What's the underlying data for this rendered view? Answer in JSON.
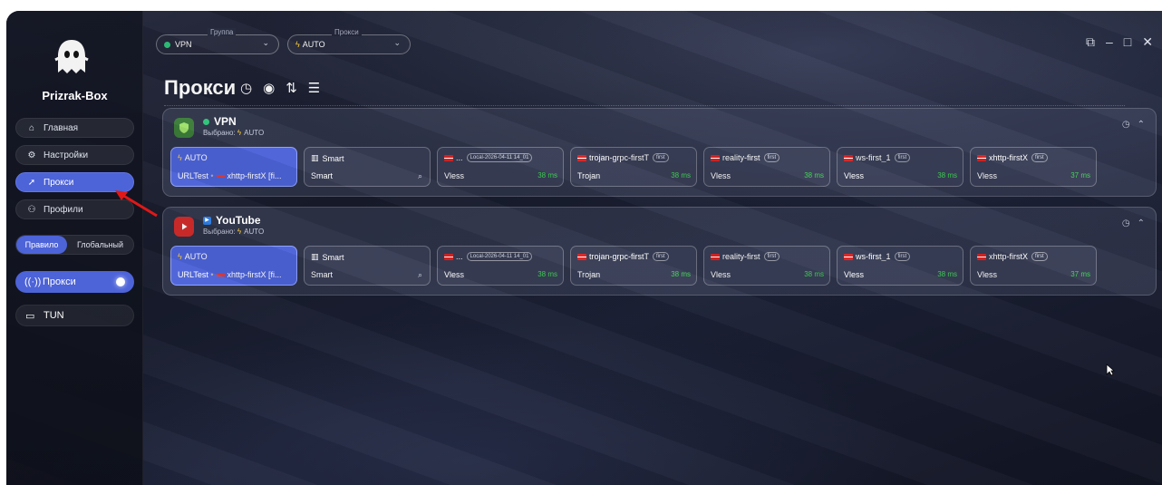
{
  "brand": "Prizrak-Box",
  "sidebar": {
    "items": [
      {
        "label": "Главная",
        "icon": "home-icon"
      },
      {
        "label": "Настройки",
        "icon": "settings-icon"
      },
      {
        "label": "Прокси",
        "icon": "rocket-icon"
      },
      {
        "label": "Профили",
        "icon": "profiles-icon"
      }
    ],
    "mode": {
      "rule": "Правило",
      "global": "Глобальный"
    },
    "switches": [
      {
        "label": "Прокси",
        "icon": "signal-icon"
      },
      {
        "label": "TUN",
        "icon": "monitor-icon"
      }
    ]
  },
  "topbar": {
    "group_legend": "Группа",
    "group_value": "VPN",
    "proxy_legend": "Прокси",
    "proxy_value": "AUTO"
  },
  "page_title": "Прокси",
  "groups": [
    {
      "name": "VPN",
      "selected": "Выбрано:",
      "selected_value": "AUTO",
      "cards": [
        {
          "name": "AUTO",
          "line2": "URLTest",
          "line2b": "xhttp-firstX [fi..."
        },
        {
          "name": "Smart",
          "line2": "Smart"
        },
        {
          "name": "...",
          "badge": "Local-2026-04-11 14_01",
          "line2": "Vless",
          "ms": "38 ms"
        },
        {
          "name": "trojan-grpc-firstT",
          "badge": "first",
          "line2": "Trojan",
          "ms": "38 ms"
        },
        {
          "name": "reality-first",
          "badge": "first",
          "line2": "Vless",
          "ms": "38 ms"
        },
        {
          "name": "ws-first_1",
          "badge": "first",
          "line2": "Vless",
          "ms": "38 ms"
        },
        {
          "name": "xhttp-firstX",
          "badge": "first",
          "line2": "Vless",
          "ms": "37 ms"
        }
      ]
    },
    {
      "name": "YouTube",
      "selected": "Выбрано:",
      "selected_value": "AUTO",
      "cards": [
        {
          "name": "AUTO",
          "line2": "URLTest",
          "line2b": "xhttp-firstX [fi..."
        },
        {
          "name": "Smart",
          "line2": "Smart"
        },
        {
          "name": "...",
          "badge": "Local-2026-04-11 14_01",
          "line2": "Vless",
          "ms": "38 ms"
        },
        {
          "name": "trojan-grpc-firstT",
          "badge": "first",
          "line2": "Trojan",
          "ms": "38 ms"
        },
        {
          "name": "reality-first",
          "badge": "first",
          "line2": "Vless",
          "ms": "38 ms"
        },
        {
          "name": "ws-first_1",
          "badge": "first",
          "line2": "Vless",
          "ms": "38 ms"
        },
        {
          "name": "xhttp-firstX",
          "badge": "first",
          "line2": "Vless",
          "ms": "37 ms"
        }
      ]
    }
  ],
  "colors": {
    "accent": "#4d63d8",
    "latency": "#3fd454",
    "status_dot": "#2fc47a",
    "flag": "#e23b3b"
  }
}
